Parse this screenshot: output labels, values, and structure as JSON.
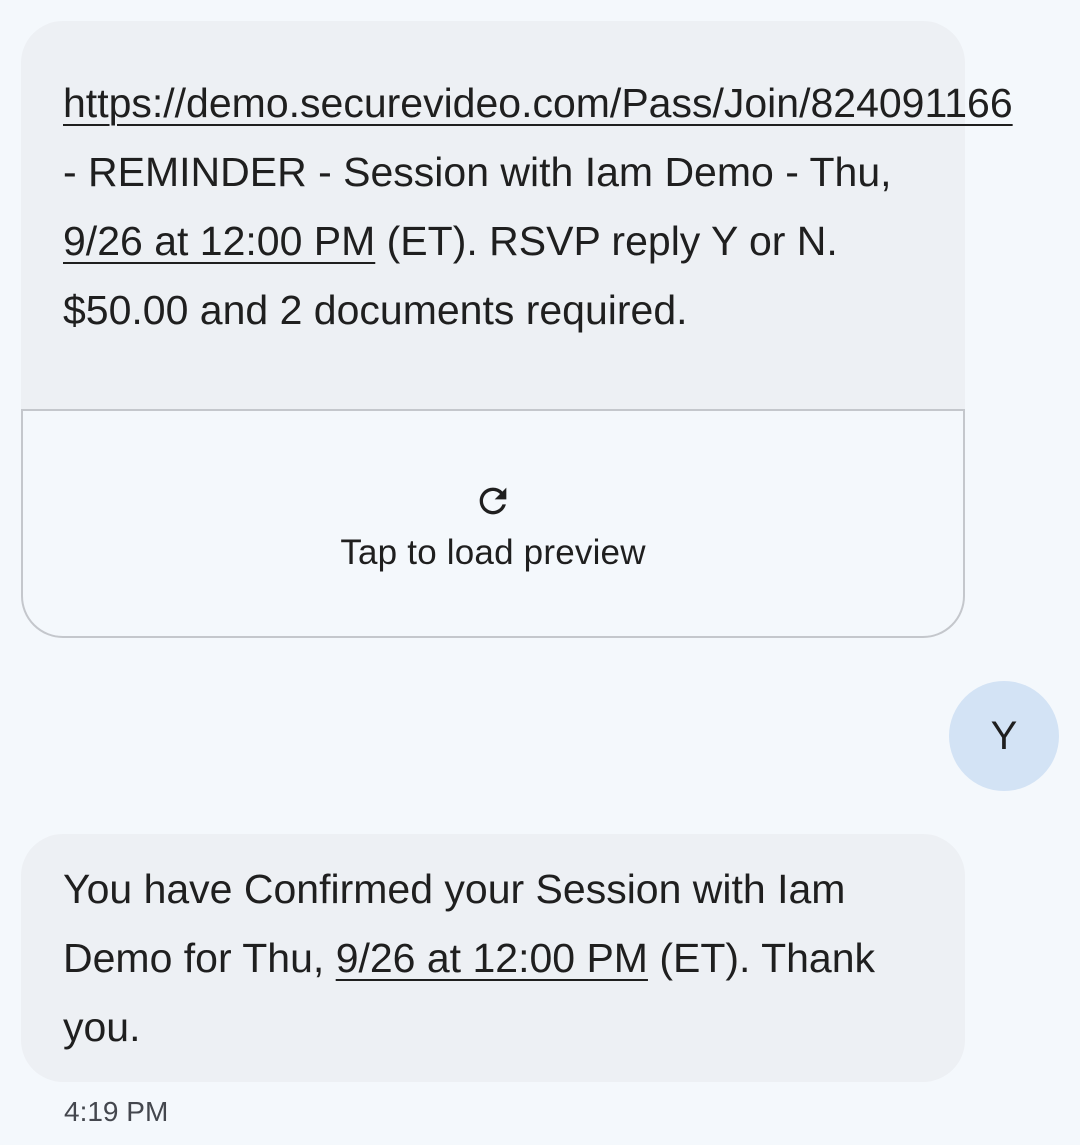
{
  "messages": [
    {
      "direction": "incoming",
      "link": "https://demo.securevideo.com/Pass/Join/824091166",
      "text_after_link": " - REMINDER - Session with Iam Demo - Thu, ",
      "date_link": "9/26 at 12:00 PM",
      "text_after_date": " (ET). RSVP reply Y or N. $50.00 and 2 documents required.",
      "preview": {
        "icon": "refresh-icon",
        "label": "Tap to load preview"
      }
    },
    {
      "direction": "outgoing",
      "text": "Y"
    },
    {
      "direction": "incoming",
      "text_before_date": "You have Confirmed your Session with Iam Demo for Thu, ",
      "date_link": "9/26 at 12:00 PM",
      "text_after_date": " (ET). Thank you.",
      "timestamp": "4:19 PM"
    }
  ],
  "colors": {
    "background": "#f4f8fc",
    "incoming_bubble": "#edf0f4",
    "outgoing_bubble": "#d3e3f5",
    "text": "#1f1f1f"
  }
}
